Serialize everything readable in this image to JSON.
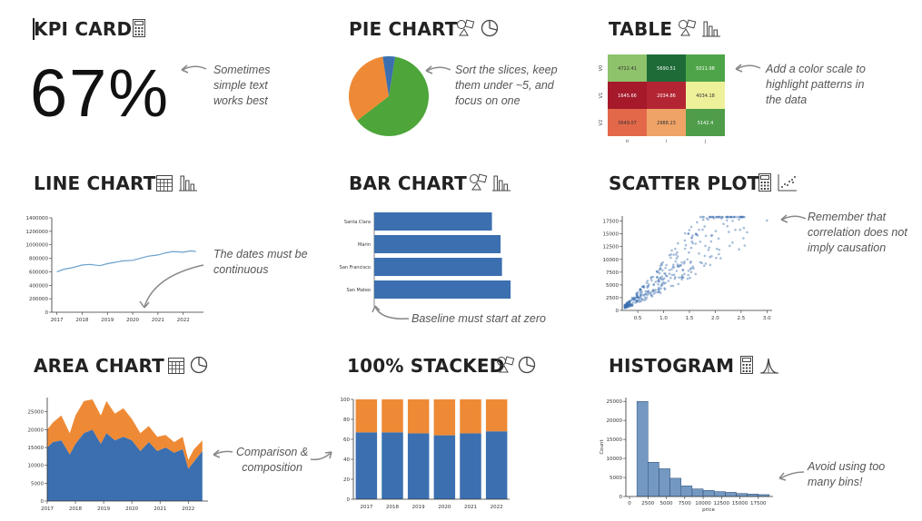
{
  "cards": [
    {
      "title": "KPI CARD",
      "note": [
        "Sometimes",
        "simple text",
        "works best"
      ],
      "icons": [
        "calculator-icon"
      ],
      "kpi_value": "67%"
    },
    {
      "title": "PIE CHART",
      "note": [
        "Sort the slices, keep",
        "them under ~5, and",
        "focus on one"
      ],
      "icons": [
        "shapes-icon",
        "pie-icon"
      ]
    },
    {
      "title": "TABLE",
      "note": [
        "Add a color scale to",
        "highlight patterns in",
        "the data"
      ],
      "icons": [
        "shapes-icon",
        "bar-icon"
      ]
    },
    {
      "title": "LINE CHART",
      "note": [
        "The dates must be",
        "continuous"
      ],
      "icons": [
        "calendar-icon",
        "bar-icon"
      ]
    },
    {
      "title": "BAR CHART",
      "note": [
        "Baseline must start at zero"
      ],
      "icons": [
        "shapes-icon",
        "bar-icon"
      ]
    },
    {
      "title": "SCATTER PLOT",
      "note": [
        "Remember that",
        "correlation does not",
        "imply causation"
      ],
      "icons": [
        "calculator-icon",
        "scatter-icon"
      ]
    },
    {
      "title": "AREA CHART",
      "note": [
        "Comparison &",
        "composition"
      ],
      "icons": [
        "calendar-icon",
        "pie-icon"
      ]
    },
    {
      "title": "100% STACKED",
      "note": [],
      "icons": [
        "shapes-icon",
        "pie-icon"
      ]
    },
    {
      "title": "HISTOGRAM",
      "note": [
        "Avoid using too",
        "many bins!"
      ],
      "icons": [
        "calculator-icon",
        "distribution-icon"
      ]
    }
  ],
  "colors": {
    "blue": "#3b6fb0",
    "orange": "#ee8a35",
    "green": "#4ea53a",
    "line": "#6aa1cd",
    "hist": "#5a86b6"
  },
  "chart_data": [
    {
      "type": "pie",
      "slices": [
        {
          "value": 62,
          "color": "#4ea53a"
        },
        {
          "value": 33,
          "color": "#ee8a35"
        },
        {
          "value": 5,
          "color": "#3b6fb0"
        }
      ]
    },
    {
      "type": "table",
      "row_labels": [
        "V0",
        "V1",
        "V2"
      ],
      "col_labels": [
        "H",
        "I",
        "J"
      ],
      "cells": [
        [
          "4722.41",
          "5690.51",
          "5011.98"
        ],
        [
          "1645.66",
          "2034.86",
          "4034.18"
        ],
        [
          "3649.07",
          "2988.23",
          "5142.4"
        ]
      ],
      "cell_colors": [
        [
          "#8ec26b",
          "#1e6b37",
          "#4ea548"
        ],
        [
          "#a5192b",
          "#b42533",
          "#eef09a"
        ],
        [
          "#e3684a",
          "#f0a366",
          "#4f9d4a"
        ]
      ]
    },
    {
      "type": "line",
      "x_ticks": [
        "2017",
        "2018",
        "2019",
        "2020",
        "2021",
        "2022"
      ],
      "y_ticks": [
        "0",
        "200000",
        "400000",
        "600000",
        "800000",
        "1000000",
        "1200000",
        "1400000"
      ],
      "ylim": [
        0,
        1400000
      ],
      "x": [
        2017,
        2017.3,
        2017.6,
        2018,
        2018.3,
        2018.7,
        2019,
        2019.3,
        2019.6,
        2020,
        2020.3,
        2020.6,
        2021,
        2021.3,
        2021.6,
        2022,
        2022.3,
        2022.5
      ],
      "values": [
        600000,
        640000,
        660000,
        700000,
        710000,
        690000,
        720000,
        740000,
        760000,
        770000,
        800000,
        830000,
        850000,
        880000,
        900000,
        890000,
        910000,
        900000
      ]
    },
    {
      "type": "bar",
      "orientation": "horizontal",
      "categories": [
        "Santa Clara",
        "Marin",
        "San Francisco",
        "San Mateo"
      ],
      "values": [
        82,
        88,
        89,
        95
      ],
      "xlim": [
        0,
        100
      ]
    },
    {
      "type": "scatter",
      "x_ticks": [
        "0.5",
        "1.0",
        "1.5",
        "2.0",
        "2.5",
        "3.0"
      ],
      "y_ticks": [
        "0",
        "2500",
        "5000",
        "7500",
        "10000",
        "12500",
        "15000",
        "17500"
      ],
      "xlim": [
        0.2,
        3.1
      ],
      "ylim": [
        0,
        18500
      ]
    },
    {
      "type": "area",
      "x_ticks": [
        "2017",
        "2018",
        "2019",
        "2020",
        "2021",
        "2022"
      ],
      "y_ticks": [
        "0",
        "5000",
        "10000",
        "15000",
        "20000",
        "25000"
      ],
      "ylim": [
        0,
        29000
      ],
      "x": [
        2017,
        2017.2,
        2017.5,
        2017.8,
        2018,
        2018.3,
        2018.6,
        2018.9,
        2019.1,
        2019.4,
        2019.7,
        2020,
        2020.3,
        2020.6,
        2020.9,
        2021.2,
        2021.5,
        2021.8,
        2022,
        2022.2,
        2022.5
      ],
      "series": [
        {
          "values": [
            15000,
            16500,
            17000,
            13000,
            16000,
            19000,
            20000,
            16000,
            19000,
            17000,
            18000,
            17000,
            14000,
            16500,
            14000,
            15000,
            13500,
            14500,
            9000,
            11000,
            14000
          ]
        },
        {
          "values": [
            5000,
            5500,
            7000,
            6000,
            8000,
            9000,
            8500,
            8000,
            9000,
            7500,
            8000,
            6000,
            5000,
            4500,
            4000,
            3500,
            3000,
            3500,
            2500,
            3500,
            3000
          ]
        }
      ]
    },
    {
      "type": "bar",
      "stacked_percent": true,
      "categories": [
        "2017",
        "2018",
        "2019",
        "2020",
        "2021",
        "2022"
      ],
      "y_ticks": [
        "0",
        "20",
        "40",
        "60",
        "80",
        "100"
      ],
      "ylim": [
        0,
        100
      ],
      "series": [
        {
          "values": [
            67,
            67,
            66,
            64,
            66,
            68
          ]
        },
        {
          "values": [
            33,
            33,
            34,
            36,
            34,
            32
          ]
        }
      ]
    },
    {
      "type": "histogram",
      "xlabel": "price",
      "ylabel": "Count",
      "x_ticks": [
        "0",
        "2500",
        "5000",
        "7500",
        "10000",
        "12500",
        "15000",
        "17500"
      ],
      "y_ticks": [
        "0",
        "5000",
        "10000",
        "15000",
        "20000",
        "25000"
      ],
      "ylim": [
        0,
        26000
      ],
      "bins": [
        [
          1000,
          2500
        ],
        [
          2500,
          4000
        ],
        [
          4000,
          5500
        ],
        [
          5500,
          7000
        ],
        [
          7000,
          8500
        ],
        [
          8500,
          10000
        ],
        [
          10000,
          11500
        ],
        [
          11500,
          13000
        ],
        [
          13000,
          14500
        ],
        [
          14500,
          16000
        ],
        [
          16000,
          17500
        ],
        [
          17500,
          19000
        ]
      ],
      "values": [
        25000,
        9000,
        7300,
        4800,
        2800,
        2000,
        1600,
        1300,
        1100,
        800,
        650,
        500
      ]
    }
  ]
}
